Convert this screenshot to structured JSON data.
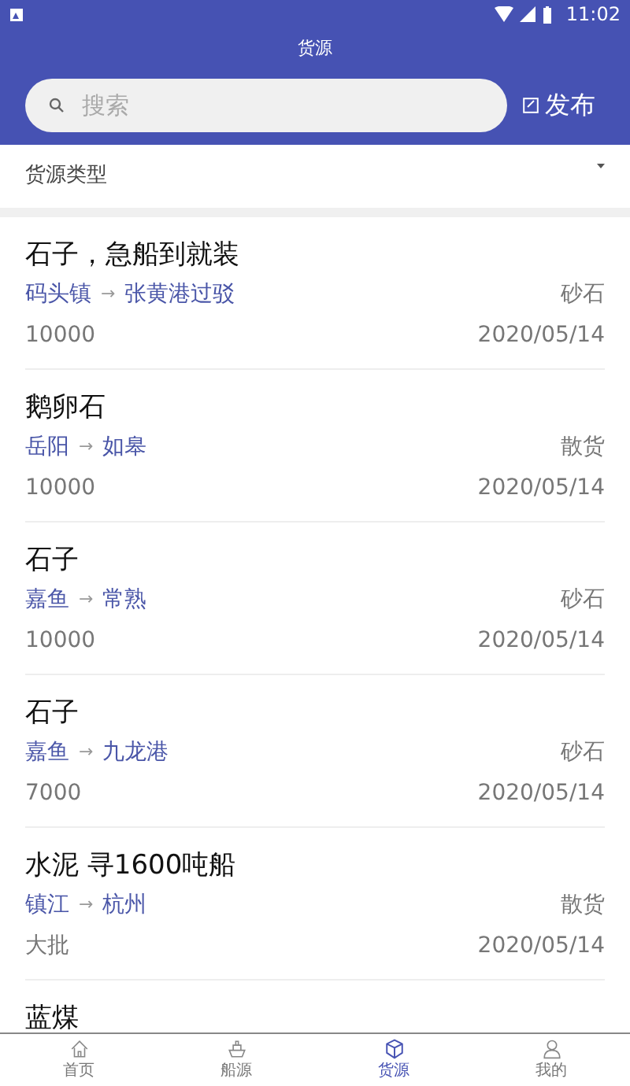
{
  "status_bar": {
    "time": "11:02"
  },
  "header": {
    "title": "货源"
  },
  "search": {
    "placeholder": "搜索"
  },
  "publish_button": {
    "label": "发布"
  },
  "filter": {
    "label": "货源类型"
  },
  "cargo_list": [
    {
      "title": "石子，急船到就装",
      "from": "码头镇",
      "to": "张黄港过驳",
      "arrow": "→",
      "type": "砂石",
      "amount": "10000",
      "date": "2020/05/14"
    },
    {
      "title": "鹅卵石",
      "from": "岳阳",
      "to": "如皋",
      "arrow": "→",
      "type": "散货",
      "amount": "10000",
      "date": "2020/05/14"
    },
    {
      "title": "石子",
      "from": "嘉鱼",
      "to": "常熟",
      "arrow": "→",
      "type": "砂石",
      "amount": "10000",
      "date": "2020/05/14"
    },
    {
      "title": "石子",
      "from": "嘉鱼",
      "to": "九龙港",
      "arrow": "→",
      "type": "砂石",
      "amount": "7000",
      "date": "2020/05/14"
    },
    {
      "title": "水泥 寻1600吨船",
      "from": "镇江",
      "to": "杭州",
      "arrow": "→",
      "type": "散货",
      "amount": "大批",
      "date": "2020/05/14"
    },
    {
      "title": "蓝煤"
    }
  ],
  "tabs": [
    {
      "label": "首页",
      "kind": "home",
      "selected": false
    },
    {
      "label": "船源",
      "kind": "ship",
      "selected": false
    },
    {
      "label": "货源",
      "kind": "cargo",
      "selected": true
    },
    {
      "label": "我的",
      "kind": "user",
      "selected": false
    }
  ]
}
